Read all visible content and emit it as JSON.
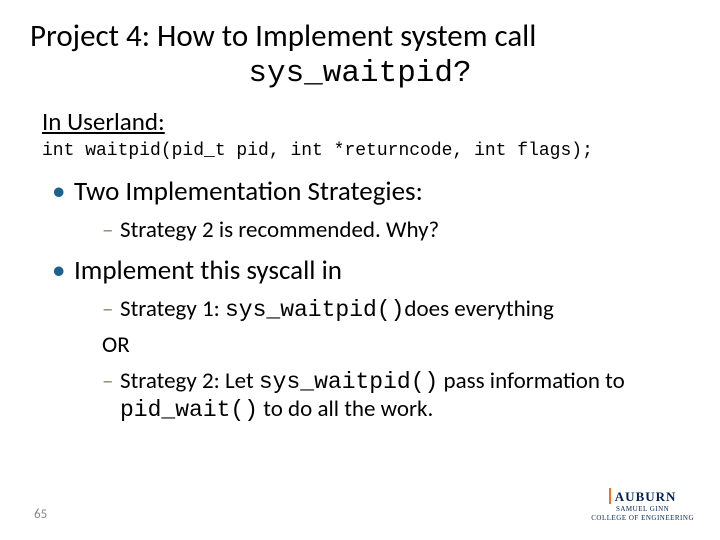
{
  "title": {
    "line1": "Project 4: How to Implement system call",
    "code": "sys_waitpid?"
  },
  "subhead": "In Userland:",
  "signature": "int waitpid(pid_t pid, int *returncode, int flags);",
  "bullets": {
    "b1": "Two Implementation Strategies:",
    "b1_sub1": "Strategy 2 is recommended. Why?",
    "b2": "Implement this syscall in",
    "b2_sub1_pre": "Strategy 1: ",
    "b2_sub1_code": "sys_waitpid()",
    "b2_sub1_post": "does everything",
    "or": "OR",
    "b2_sub2_pre": "Strategy 2: Let ",
    "b2_sub2_code1": "sys_waitpid()",
    "b2_sub2_mid": " pass information to ",
    "b2_sub2_code2": "pid_wait()",
    "b2_sub2_post": " to do all the work."
  },
  "page_number": "65",
  "logo": {
    "name": "AUBURN",
    "sub1": "SAMUEL GINN",
    "sub2": "COLLEGE OF ENGINEERING"
  }
}
